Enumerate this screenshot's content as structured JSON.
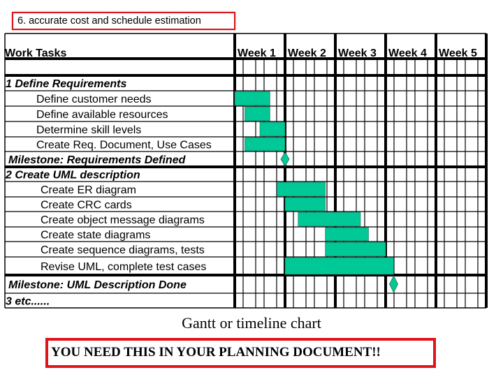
{
  "slide": {
    "heading": "6. accurate cost and schedule estimation",
    "caption": "Gantt or timeline chart",
    "note": "YOU NEED THIS IN YOUR PLANNING DOCUMENT!!"
  },
  "colors": {
    "bar": "#00c896",
    "grid": "#000000",
    "heading_border": "#d9141b",
    "note_border": "#e0141b"
  },
  "chart_data": {
    "type": "gantt",
    "title": "Gantt or timeline chart",
    "task_column_header": "Work Tasks",
    "weeks": [
      "Week 1",
      "Week 2",
      "Week 3",
      "Week 4",
      "Week 5"
    ],
    "days_per_week": 5,
    "unit": "day",
    "rows": [
      {
        "kind": "section",
        "label": "1 Define Requirements"
      },
      {
        "kind": "task",
        "label": "Define customer needs",
        "start": 0,
        "end": 3.5
      },
      {
        "kind": "task",
        "label": "Define available resources",
        "start": 1,
        "end": 3.5
      },
      {
        "kind": "task",
        "label": "Determine skill levels",
        "start": 2.5,
        "end": 5
      },
      {
        "kind": "task",
        "label": "Create Req. Document, Use Cases",
        "start": 1,
        "end": 5
      },
      {
        "kind": "milestone",
        "label": "Milestone: Requirements Defined",
        "at": 5
      },
      {
        "kind": "section",
        "label": "2  Create UML description"
      },
      {
        "kind": "task",
        "label": "Create ER diagram",
        "start": 4.2,
        "end": 9
      },
      {
        "kind": "task",
        "label": "Create CRC cards",
        "start": 5,
        "end": 9
      },
      {
        "kind": "task",
        "label": "Create object message diagrams",
        "start": 6.3,
        "end": 12.5
      },
      {
        "kind": "task",
        "label": "Create state diagrams",
        "start": 9,
        "end": 13.3
      },
      {
        "kind": "task",
        "label": "Create sequence diagrams, tests",
        "start": 9,
        "end": 15
      },
      {
        "kind": "task",
        "label": "Revise UML, complete test cases",
        "start": 5,
        "end": 15.8
      },
      {
        "kind": "milestone",
        "label": "Milestone: UML Description Done",
        "at": 15.8
      },
      {
        "kind": "section",
        "label": "3 etc......"
      }
    ]
  }
}
